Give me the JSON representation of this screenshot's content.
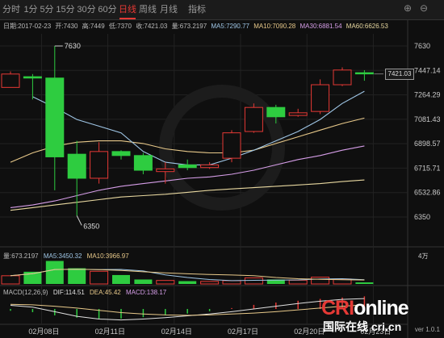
{
  "tabs": [
    {
      "label": "分时",
      "active": false
    },
    {
      "label": "1分",
      "active": false
    },
    {
      "label": "5分",
      "active": false
    },
    {
      "label": "15分",
      "active": false
    },
    {
      "label": "30分",
      "active": false
    },
    {
      "label": "60分",
      "active": false
    },
    {
      "label": "日线",
      "active": true
    },
    {
      "label": "周线",
      "active": false
    },
    {
      "label": "月线",
      "active": false
    },
    {
      "label": "指标",
      "active": false
    }
  ],
  "info": {
    "date": "日期:2017-02-23",
    "open": "开:7430",
    "high": "高:7449",
    "low": "低:7370",
    "close": "收:7421.03",
    "volume": "量:673.2197",
    "ma5": "MA5:7290.77",
    "ma10": "MA10:7090.28",
    "ma30": "MA30:6881.54",
    "ma60": "MA60:6626.53"
  },
  "vol_info": {
    "volume": "量:673.2197",
    "ma5": "MA5:3450.32",
    "ma10": "MA10:3966.97",
    "scale": "4万"
  },
  "macd_info": {
    "title": "MACD(12,26,9)",
    "dif": "DIF:114.51",
    "dea": "DEA:45.42",
    "macd": "MACD:138.17"
  },
  "last_price_label": "7421.03",
  "watermark": {
    "logo_part1": "CRI",
    "logo_part2": "online",
    "sub": "国际在线 cri.cn"
  },
  "version": "ver 1.0.1",
  "colors": {
    "up": "#e53935",
    "down": "#2ecc40",
    "ma5": "#9fc6e6",
    "ma10": "#e8c98a",
    "ma30": "#d69ee8",
    "ma60": "#e8d8a0",
    "dif": "#e0e0e0",
    "dea": "#e8c98a"
  },
  "chart_data": {
    "type": "candlestick",
    "yticks": [
      6350,
      6532.86,
      6715.71,
      6898.57,
      7081.43,
      7264.29,
      7447.14,
      7630
    ],
    "ylim": [
      6350,
      7630
    ],
    "xticks": [
      {
        "label": "02月08日",
        "index": 1
      },
      {
        "label": "02月11日",
        "index": 4
      },
      {
        "label": "02月14日",
        "index": 7
      },
      {
        "label": "02月17日",
        "index": 10
      },
      {
        "label": "02月20日",
        "index": 13
      },
      {
        "label": "02月23日",
        "index": 16
      }
    ],
    "annotations": {
      "high": "7630",
      "low": "6350"
    },
    "candles": [
      {
        "o": 7320,
        "h": 7440,
        "l": 7320,
        "c": 7420
      },
      {
        "o": 7400,
        "h": 7420,
        "l": 7230,
        "c": 7390
      },
      {
        "o": 7390,
        "h": 7630,
        "l": 6550,
        "c": 6800
      },
      {
        "o": 6820,
        "h": 6920,
        "l": 6360,
        "c": 6640
      },
      {
        "o": 6640,
        "h": 6910,
        "l": 6600,
        "c": 6840
      },
      {
        "o": 6840,
        "h": 6850,
        "l": 6780,
        "c": 6810
      },
      {
        "o": 6810,
        "h": 6830,
        "l": 6670,
        "c": 6700
      },
      {
        "o": 6690,
        "h": 6760,
        "l": 6600,
        "c": 6710
      },
      {
        "o": 6740,
        "h": 6780,
        "l": 6700,
        "c": 6720
      },
      {
        "o": 6720,
        "h": 6760,
        "l": 6710,
        "c": 6740
      },
      {
        "o": 6790,
        "h": 7000,
        "l": 6760,
        "c": 6980
      },
      {
        "o": 6990,
        "h": 7200,
        "l": 6980,
        "c": 7170
      },
      {
        "o": 7170,
        "h": 7190,
        "l": 7050,
        "c": 7100
      },
      {
        "o": 7110,
        "h": 7160,
        "l": 7100,
        "c": 7130
      },
      {
        "o": 7140,
        "h": 7380,
        "l": 7120,
        "c": 7340
      },
      {
        "o": 7340,
        "h": 7470,
        "l": 7330,
        "c": 7450
      },
      {
        "o": 7430,
        "h": 7449,
        "l": 7370,
        "c": 7421.03
      }
    ],
    "ma5": [
      null,
      7250,
      7170,
      7080,
      7030,
      6980,
      6840,
      6760,
      6740,
      6740,
      6790,
      6850,
      6920,
      6990,
      7080,
      7200,
      7291
    ],
    "ma10": [
      6760,
      6830,
      6880,
      6910,
      6920,
      6920,
      6900,
      6860,
      6840,
      6830,
      6830,
      6850,
      6900,
      6950,
      7000,
      7050,
      7090
    ],
    "ma30": [
      6420,
      6440,
      6470,
      6510,
      6550,
      6580,
      6600,
      6620,
      6640,
      6650,
      6670,
      6700,
      6740,
      6780,
      6810,
      6850,
      6882
    ],
    "ma60": [
      6400,
      6420,
      6440,
      6460,
      6480,
      6500,
      6510,
      6520,
      6535,
      6550,
      6560,
      6570,
      6580,
      6590,
      6600,
      6615,
      6627
    ],
    "volume": [
      3500,
      5200,
      9800,
      6700,
      5400,
      3800,
      1900,
      1500,
      1200,
      1100,
      1400,
      2600,
      1900,
      1600,
      2900,
      2100,
      673
    ],
    "volume_max": 40000,
    "macd_hist": [
      -20,
      -35,
      -70,
      -95,
      -110,
      -105,
      -90,
      -70,
      -50,
      -25,
      10,
      45,
      70,
      90,
      110,
      125,
      138
    ],
    "dif": [
      40,
      20,
      -30,
      -80,
      -110,
      -120,
      -110,
      -95,
      -75,
      -55,
      -30,
      0,
      30,
      60,
      85,
      105,
      114
    ],
    "dea": [
      50,
      45,
      30,
      10,
      -15,
      -40,
      -55,
      -65,
      -70,
      -65,
      -55,
      -45,
      -30,
      -10,
      10,
      30,
      45
    ],
    "macd_range": [
      -150,
      150
    ]
  }
}
